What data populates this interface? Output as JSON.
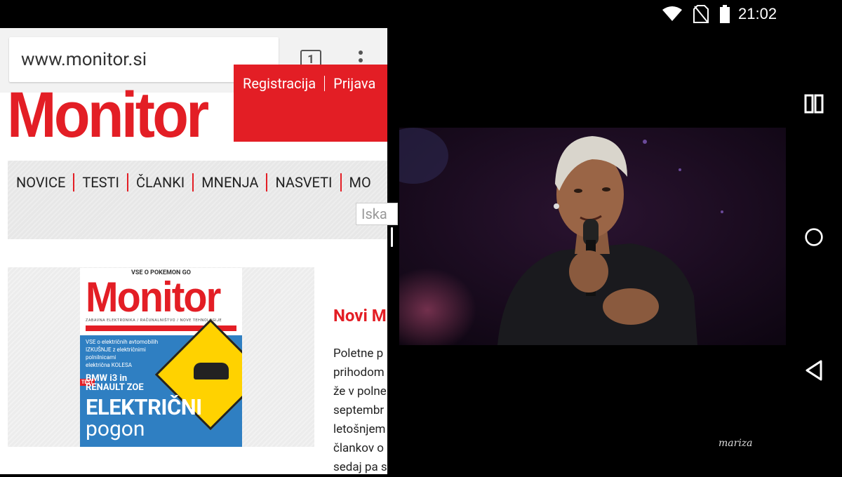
{
  "status_bar": {
    "time": "21:02",
    "icons": [
      "wifi-icon",
      "no-sim-icon",
      "battery-icon"
    ]
  },
  "browser": {
    "url": "www.monitor.si",
    "tab_count": "1",
    "menu_icon": "more-vert-icon"
  },
  "site": {
    "logo_text": "Monitor",
    "user_links": [
      "Registracija",
      "Prijava"
    ],
    "nav": [
      "NOVICE",
      "TESTI",
      "ČLANKI",
      "MNENJA",
      "NASVETI",
      "MO"
    ],
    "search_placeholder": "Iska"
  },
  "cover": {
    "tag": "VSE O POKEMON GO",
    "logo": "Monitor",
    "subtitle": "ZABAVNA ELEKTRONIKA / RAČUNALNIŠTVO / NOVE TEHNOLOGIJE",
    "lines": [
      "VSE o električnih avtomobilih",
      "IZKUŠNJE z električnimi polnilnicami",
      "električna KOLESA"
    ],
    "test_badge": "TEST",
    "bmw_line1": "BMW i3 in",
    "bmw_line2": "RENAULT ZOE",
    "headline": "ELEKTRIČNI",
    "headline2": "pogon"
  },
  "article": {
    "title": "Novi M",
    "lines": [
      "Poletne p",
      "prihodom",
      "že v polne",
      "septembr",
      "letošnjem",
      "člankov o",
      "sedaj pa s"
    ]
  },
  "video": {
    "watermark": "mariza"
  },
  "nav_bar": {
    "buttons": [
      "recents-icon",
      "home-icon",
      "back-icon"
    ]
  },
  "colors": {
    "brand_red": "#e31e25",
    "status_bg": "#000000"
  }
}
